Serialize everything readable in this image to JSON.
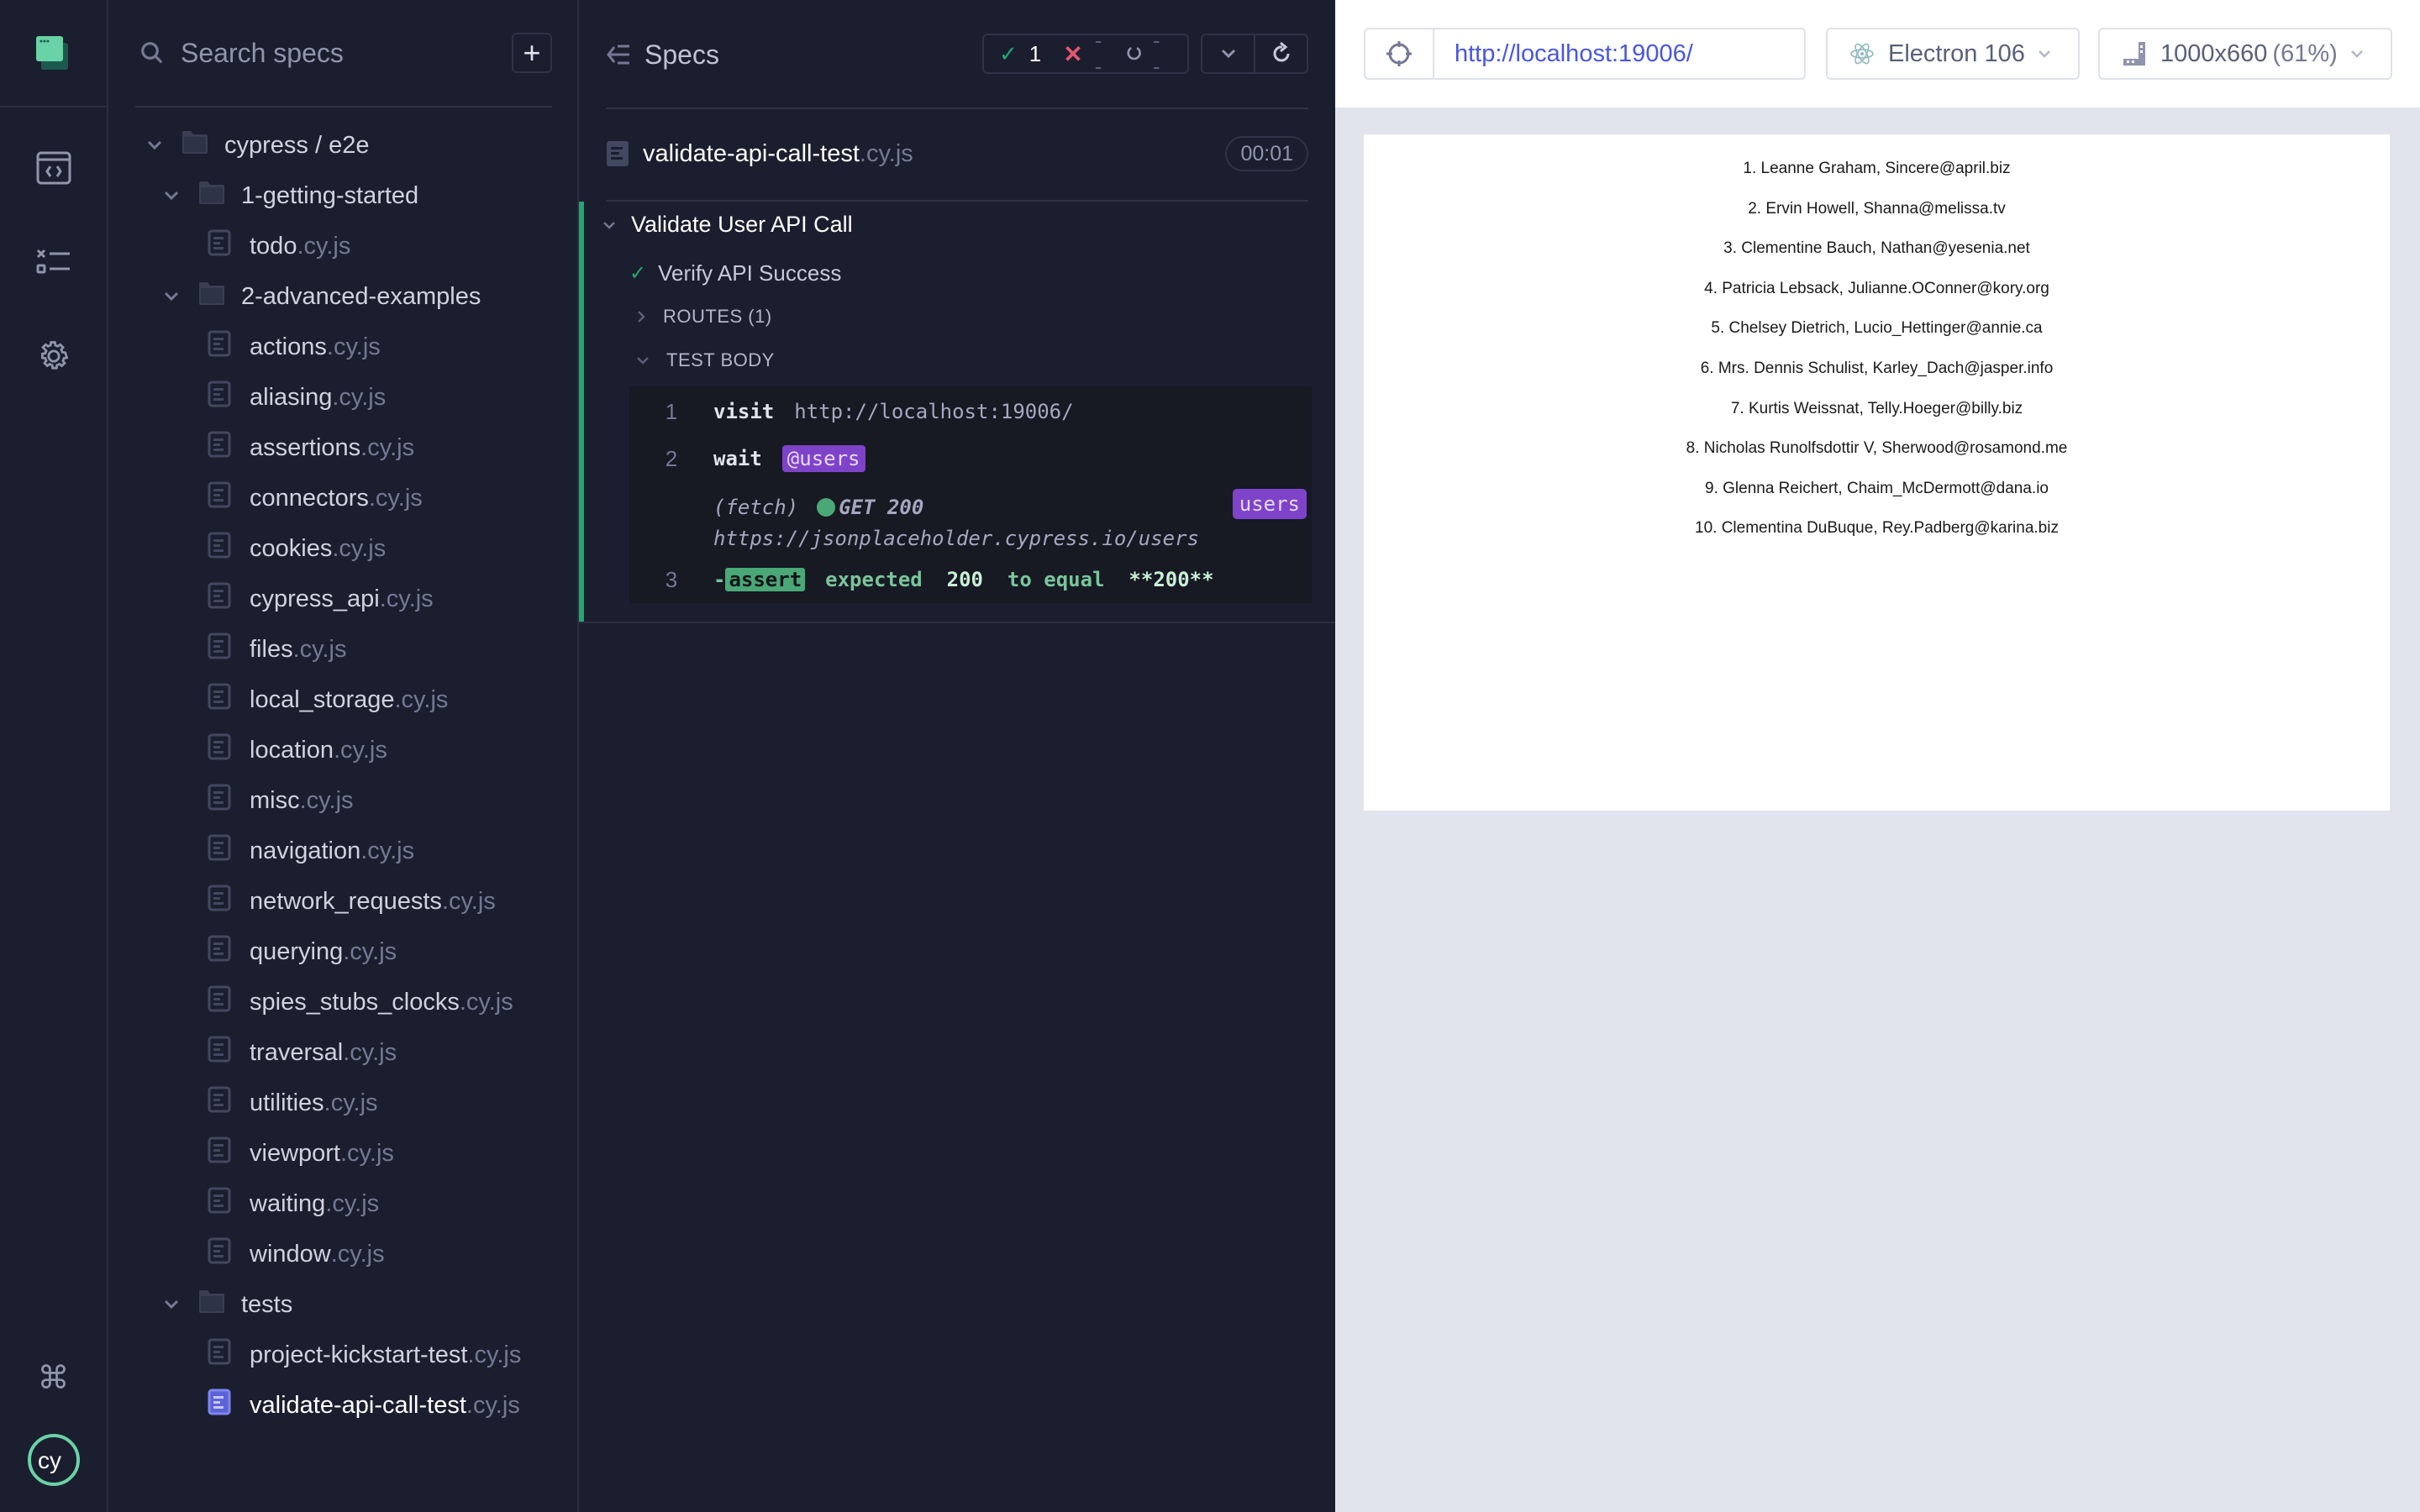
{
  "search": {
    "placeholder": "Search specs"
  },
  "spec_tree": {
    "root": "cypress / e2e",
    "folders": [
      {
        "name": "1-getting-started",
        "files": [
          {
            "name": "todo",
            "ext": ".cy.js"
          }
        ]
      },
      {
        "name": "2-advanced-examples",
        "files": [
          {
            "name": "actions",
            "ext": ".cy.js"
          },
          {
            "name": "aliasing",
            "ext": ".cy.js"
          },
          {
            "name": "assertions",
            "ext": ".cy.js"
          },
          {
            "name": "connectors",
            "ext": ".cy.js"
          },
          {
            "name": "cookies",
            "ext": ".cy.js"
          },
          {
            "name": "cypress_api",
            "ext": ".cy.js"
          },
          {
            "name": "files",
            "ext": ".cy.js"
          },
          {
            "name": "local_storage",
            "ext": ".cy.js"
          },
          {
            "name": "location",
            "ext": ".cy.js"
          },
          {
            "name": "misc",
            "ext": ".cy.js"
          },
          {
            "name": "navigation",
            "ext": ".cy.js"
          },
          {
            "name": "network_requests",
            "ext": ".cy.js"
          },
          {
            "name": "querying",
            "ext": ".cy.js"
          },
          {
            "name": "spies_stubs_clocks",
            "ext": ".cy.js"
          },
          {
            "name": "traversal",
            "ext": ".cy.js"
          },
          {
            "name": "utilities",
            "ext": ".cy.js"
          },
          {
            "name": "viewport",
            "ext": ".cy.js"
          },
          {
            "name": "waiting",
            "ext": ".cy.js"
          },
          {
            "name": "window",
            "ext": ".cy.js"
          }
        ]
      },
      {
        "name": "tests",
        "files": [
          {
            "name": "project-kickstart-test",
            "ext": ".cy.js"
          },
          {
            "name": "validate-api-call-test",
            "ext": ".cy.js",
            "selected": true
          }
        ]
      }
    ]
  },
  "reporter": {
    "specs_label": "Specs",
    "stats": {
      "passed": "1",
      "failed": "--",
      "pending": "--"
    },
    "spec_name": "validate-api-call-test",
    "spec_ext": ".cy.js",
    "duration": "00:01",
    "suite_title": "Validate User API Call",
    "test_title": "Verify API Success",
    "routes_label": "ROUTES (1)",
    "test_body_label": "TEST BODY",
    "commands": [
      {
        "num": "1",
        "name": "visit",
        "message": "http://localhost:19006/"
      },
      {
        "num": "2",
        "name": "wait",
        "alias": "@users"
      },
      {
        "num": "3",
        "name": "assert",
        "prefix": "-",
        "message_parts": [
          "expected",
          "200",
          "to equal",
          "**200**"
        ]
      }
    ],
    "fetch": {
      "label": "(fetch)",
      "method_status": "GET 200",
      "url": "https://jsonplaceholder.cypress.io/users",
      "alias": "users"
    }
  },
  "aut": {
    "url": "http://localhost:19006/",
    "browser": "Electron 106",
    "viewport": "1000x660",
    "viewport_scale": "(61%)",
    "users": [
      "1. Leanne Graham, Sincere@april.biz",
      "2. Ervin Howell, Shanna@melissa.tv",
      "3. Clementine Bauch, Nathan@yesenia.net",
      "4. Patricia Lebsack, Julianne.OConner@kory.org",
      "5. Chelsey Dietrich, Lucio_Hettinger@annie.ca",
      "6. Mrs. Dennis Schulist, Karley_Dach@jasper.info",
      "7. Kurtis Weissnat, Telly.Hoeger@billy.biz",
      "8. Nicholas Runolfsdottir V, Sherwood@rosamond.me",
      "9. Glenna Reichert, Chaim_McDermott@dana.io",
      "10. Clementina DuBuque, Rey.Padberg@karina.biz"
    ]
  },
  "colors": {
    "pass": "#1fa971",
    "fail": "#e45770",
    "alias": "#7f43c9",
    "link": "#4956e3",
    "selected": "#a3a8f2"
  }
}
